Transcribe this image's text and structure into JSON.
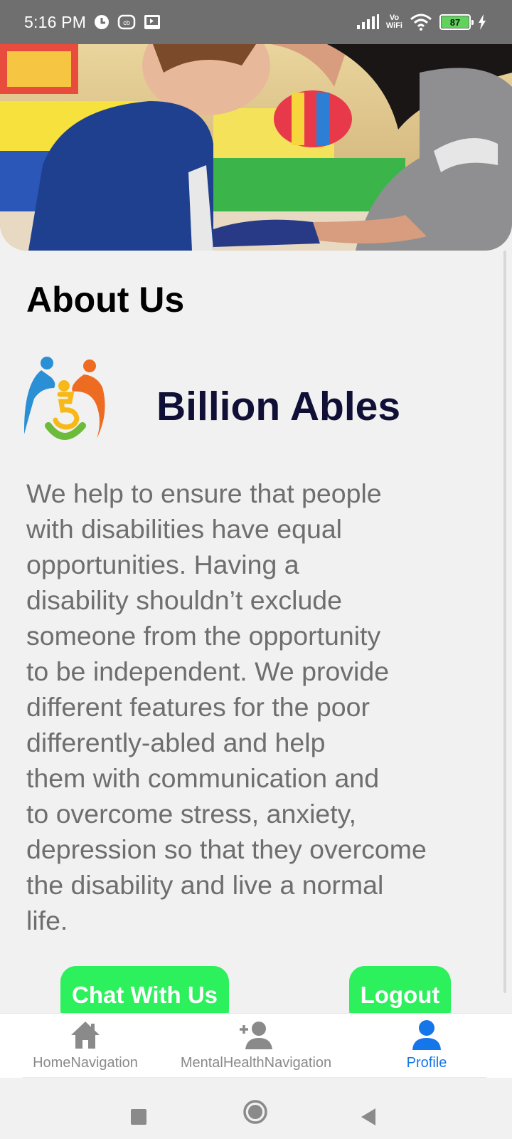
{
  "status_bar": {
    "time": "5:16 PM",
    "network_label_top": "Vo",
    "network_label_bottom": "WiFi",
    "battery_level": "87"
  },
  "hero": {
    "image": "child-and-caregiver-photo"
  },
  "about": {
    "title": "About Us",
    "brand_name": "Billion Ables",
    "description": "We help to ensure that people\nwith disabilities have equal\nopportunities. Having a\ndisability shouldn’t exclude\nsomeone from the opportunity\nto be independent. We provide\ndifferent features for the poor\ndifferently-abled and help\nthem with communication and\nto overcome stress, anxiety,\ndepression so that they overcome\nthe disability and live a normal\nlife."
  },
  "buttons": {
    "chat": "Chat With Us",
    "logout": "Logout"
  },
  "bottom_nav": {
    "items": [
      {
        "label": "HomeNavigation",
        "icon": "home-icon"
      },
      {
        "label": "MentalHealthNavigation",
        "icon": "add-person-icon"
      },
      {
        "label": "Profile",
        "icon": "person-icon",
        "active": true
      }
    ]
  },
  "colors": {
    "button_green": "#2cf05c",
    "active_blue": "#1476e8",
    "brand_navy": "#101036",
    "body_text": "#6e6e6e"
  }
}
